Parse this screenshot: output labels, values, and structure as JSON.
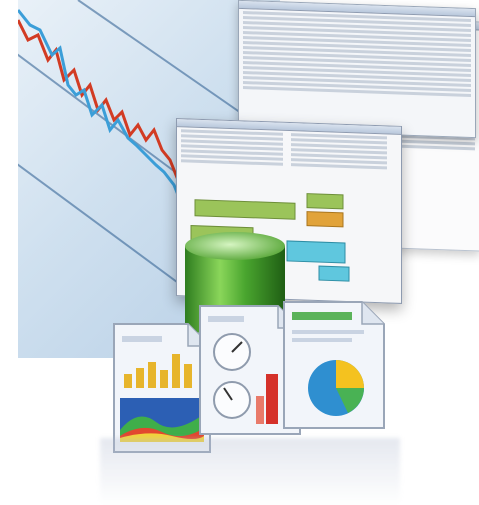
{
  "scene": {
    "description_free": true,
    "accent_colors": {
      "chart_red": "#d23b23",
      "chart_blue": "#3b9ed8",
      "db_green": "#4aa62f",
      "window_border": "#8e9bb0"
    }
  },
  "icons": [
    {
      "name": "database-icon"
    },
    {
      "name": "bar-chart-report-icon"
    },
    {
      "name": "gauge-report-icon"
    },
    {
      "name": "pie-chart-report-icon"
    }
  ],
  "windows": [
    {
      "name": "back-ide-window"
    },
    {
      "name": "front-ide-window"
    }
  ]
}
